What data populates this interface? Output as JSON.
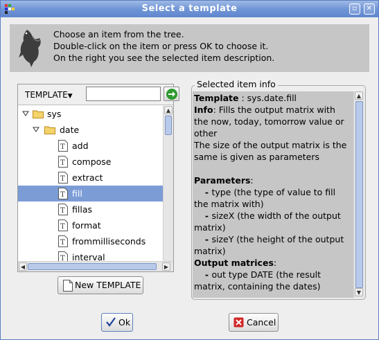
{
  "window": {
    "title": "Select a template",
    "controls": {
      "restore_icon": "restore-icon",
      "close_icon": "close-icon"
    }
  },
  "header": {
    "lines": [
      "Choose an item from the tree.",
      "Double-click on the item or press OK to choose it.",
      "On the right you see the selected item description."
    ],
    "bird_icon": "bird-logo"
  },
  "tree_panel": {
    "dropdown_label": "TEMPLATE",
    "search_value": "",
    "go_icon": "arrow-right-icon",
    "items": [
      {
        "label": "sys",
        "kind": "folder",
        "depth": 0,
        "expanded": true,
        "selected": false
      },
      {
        "label": "date",
        "kind": "folder",
        "depth": 1,
        "expanded": true,
        "selected": false
      },
      {
        "label": "add",
        "kind": "template",
        "depth": 2,
        "selected": false
      },
      {
        "label": "compose",
        "kind": "template",
        "depth": 2,
        "selected": false
      },
      {
        "label": "extract",
        "kind": "template",
        "depth": 2,
        "selected": false
      },
      {
        "label": "fill",
        "kind": "template",
        "depth": 2,
        "selected": true
      },
      {
        "label": "fillas",
        "kind": "template",
        "depth": 2,
        "selected": false
      },
      {
        "label": "format",
        "kind": "template",
        "depth": 2,
        "selected": false
      },
      {
        "label": "frommilliseconds",
        "kind": "template",
        "depth": 2,
        "selected": false
      },
      {
        "label": "interval",
        "kind": "template",
        "depth": 2,
        "selected": false
      }
    ],
    "new_button_label": "New TEMPLATE"
  },
  "info_panel": {
    "legend": "Selected item info",
    "template_label": "Template",
    "template_value": " : sys.date.fill",
    "info_label": "Info",
    "info_value": ": Fills the output matrix with the now, today, tomorrow value or other",
    "size_note": "The size of the output matrix is the same is given as parameters",
    "parameters_label": "Parameters",
    "params": [
      {
        "dash": "- ",
        "name": "type",
        "desc": " (the type of value to fill the matrix with)"
      },
      {
        "dash": "- ",
        "name": "sizeX",
        "desc": " (the width of the output matrix)"
      },
      {
        "dash": "- ",
        "name": "sizeY",
        "desc": " (the height of the output matrix)"
      }
    ],
    "outputs_label": "Output matrices",
    "outputs": [
      {
        "dash": "- ",
        "name": "out type DATE",
        "desc": " (the result matrix, containing the dates)"
      }
    ]
  },
  "buttons": {
    "ok_label": "Ok",
    "cancel_label": "Cancel",
    "ok_icon": "checkmark-icon",
    "cancel_icon": "cancel-icon"
  },
  "colors": {
    "titlebar": "#6f94d5",
    "selection": "#7c9cd6",
    "info_bg": "#c6c6c6",
    "go_arrow": "#2e9a2e",
    "cancel_red": "#d22828"
  }
}
